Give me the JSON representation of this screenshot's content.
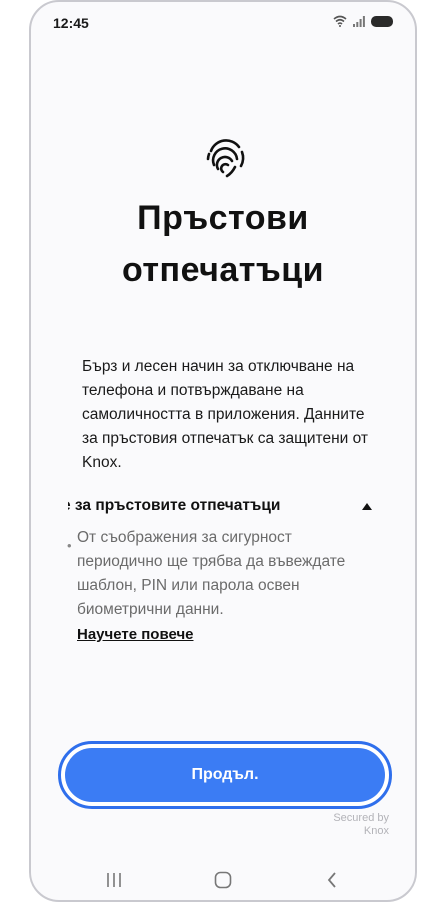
{
  "status_bar": {
    "time": "12:45"
  },
  "screen": {
    "title_line1": "Пръстови",
    "title_line2": "отпечатъци",
    "description": "Бърз и лесен начин за отключване на телефона и потвърждаване на самоличността в приложения. Данните за пръстовия отпечатък са защитени от Knox.",
    "section_header": "е за пръстовите отпечатъци",
    "bullet_text": "От съображения за сигурност периодично ще трябва да въвеждате шаблон, PIN или парола освен биометрични данни.",
    "learn_more": "Научете повече",
    "continue_label": "Продъл.",
    "secured_line1": "Secured by",
    "secured_line2": "Knox"
  },
  "colors": {
    "accent": "#3b7cf4",
    "accent_border": "#2f6fec"
  },
  "icons": [
    "wifi-icon",
    "signal-icon",
    "battery-icon",
    "fingerprint-icon",
    "chevron-up-icon",
    "recents-icon",
    "home-icon",
    "back-icon"
  ]
}
